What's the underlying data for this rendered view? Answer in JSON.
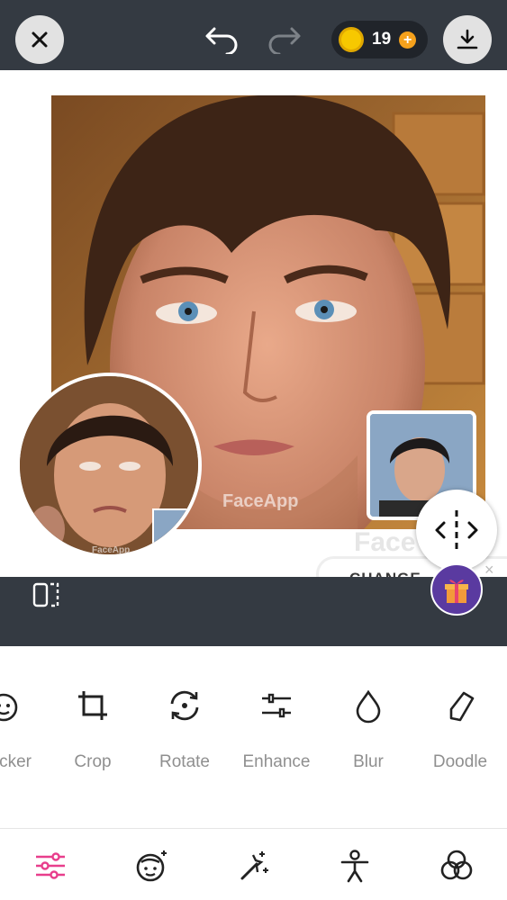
{
  "header": {
    "close_icon": "close-icon",
    "undo_icon": "undo-icon",
    "redo_icon": "redo-icon",
    "coins": {
      "count": "19",
      "plus_label": "+"
    },
    "download_icon": "download-icon"
  },
  "canvas": {
    "watermark_main": "FaceApp",
    "watermark_small": "FaceApp",
    "watermark_big": "Face",
    "change_button_label": "CHANGE",
    "close_ad_label": "×"
  },
  "tools": [
    {
      "label": "cker",
      "icon": "sticker-icon"
    },
    {
      "label": "Crop",
      "icon": "crop-icon"
    },
    {
      "label": "Rotate",
      "icon": "rotate-icon"
    },
    {
      "label": "Enhance",
      "icon": "enhance-icon"
    },
    {
      "label": "Blur",
      "icon": "blur-icon"
    },
    {
      "label": "Doodle",
      "icon": "doodle-icon"
    }
  ],
  "bottom_nav": [
    {
      "icon": "adjust-icon",
      "active": true
    },
    {
      "icon": "face-icon",
      "active": false
    },
    {
      "icon": "magic-wand-icon",
      "active": false
    },
    {
      "icon": "body-icon",
      "active": false
    },
    {
      "icon": "filters-icon",
      "active": false
    }
  ],
  "colors": {
    "topbar": "#343a42",
    "accent": "#e83e8c",
    "coin": "#f7c800",
    "tool_label": "#8f8f8f"
  }
}
